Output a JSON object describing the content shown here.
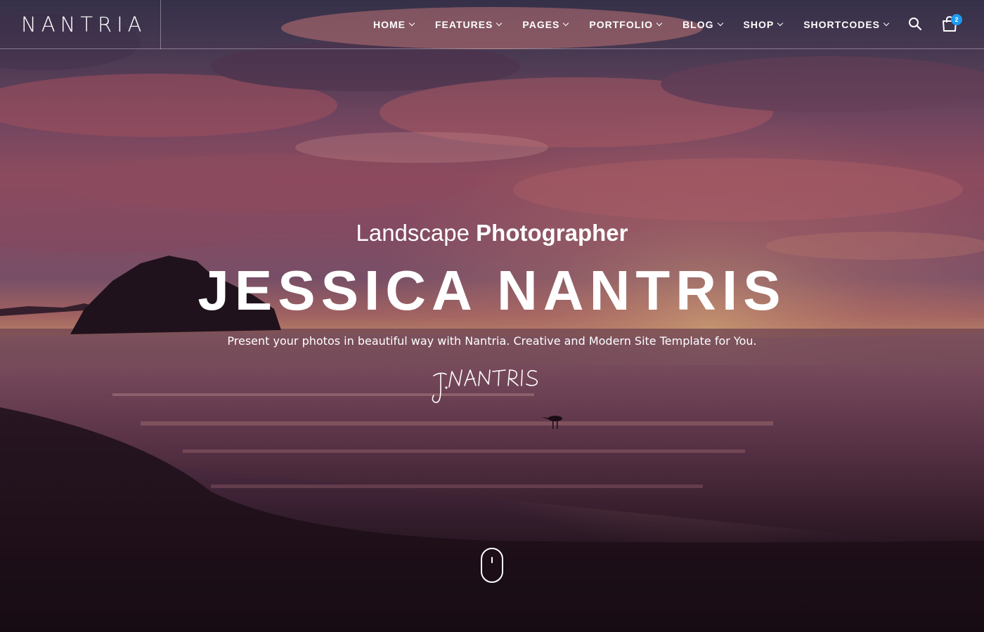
{
  "header": {
    "logo": "NANTRIA",
    "nav": [
      {
        "label": "HOME"
      },
      {
        "label": "FEATURES"
      },
      {
        "label": "PAGES"
      },
      {
        "label": "PORTFOLIO"
      },
      {
        "label": "BLOG"
      },
      {
        "label": "SHOP"
      },
      {
        "label": "SHORTCODES"
      }
    ],
    "search_icon": "search-icon",
    "cart_icon": "shopping-bag-icon",
    "cart_count": "2"
  },
  "hero": {
    "subtitle_light": "Landscape",
    "subtitle_bold": "Photographer",
    "title": "JESSICA NANTRIS",
    "description": "Present your photos in beautiful way with Nantria. Creative and Modern Site Template for You.",
    "signature": "J.NANTRIS",
    "scroll_icon": "mouse-scroll-icon"
  },
  "colors": {
    "accent": "#1e9af0",
    "text": "#ffffff"
  }
}
